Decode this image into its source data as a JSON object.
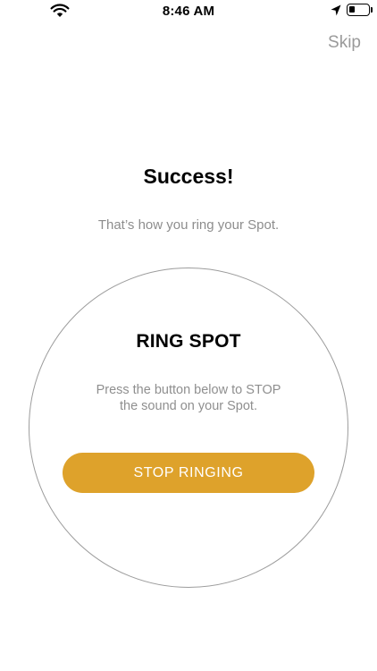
{
  "status_bar": {
    "time": "8:46 AM",
    "icons": [
      "wifi-icon",
      "location-arrow-icon",
      "battery-icon"
    ]
  },
  "header": {
    "skip_label": "Skip"
  },
  "main": {
    "title": "Success!",
    "subtitle": "That’s how you ring your Spot."
  },
  "ring_card": {
    "title": "RING SPOT",
    "description_line1": "Press the button below to STOP",
    "description_line2": "the sound on your Spot.",
    "button_label": "STOP RINGING"
  },
  "colors": {
    "accent": "#dea22b",
    "muted_text": "#8d8d8d",
    "circle_border": "#9c9c9c"
  }
}
